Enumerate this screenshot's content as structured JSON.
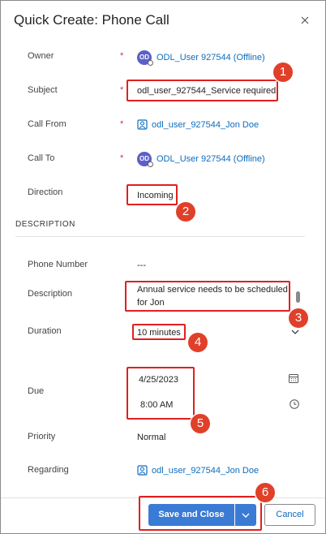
{
  "dialog": {
    "title": "Quick Create: Phone Call"
  },
  "fields": {
    "owner": {
      "label": "Owner",
      "required": "*",
      "avatar": "OD",
      "value": "ODL_User 927544 (Offline)"
    },
    "subject": {
      "label": "Subject",
      "required": "*",
      "value": "odl_user_927544_Service required"
    },
    "call_from": {
      "label": "Call From",
      "required": "*",
      "value": "odl_user_927544_Jon Doe"
    },
    "call_to": {
      "label": "Call To",
      "required": "*",
      "avatar": "OD",
      "value": "ODL_User 927544 (Offline)"
    },
    "direction": {
      "label": "Direction",
      "value": "Incoming"
    }
  },
  "description_section": {
    "title": "DESCRIPTION",
    "phone_number": {
      "label": "Phone Number",
      "value": "---"
    },
    "description": {
      "label": "Description",
      "line1": "Annual service needs to be scheduled",
      "line2": "for Jon"
    },
    "duration": {
      "label": "Duration",
      "value": "10 minutes"
    },
    "due": {
      "label": "Due",
      "date": "4/25/2023",
      "time": "8:00 AM"
    },
    "priority": {
      "label": "Priority",
      "value": "Normal"
    },
    "regarding": {
      "label": "Regarding",
      "value": "odl_user_927544_Jon Doe"
    }
  },
  "footer": {
    "save_label": "Save and Close",
    "cancel_label": "Cancel"
  },
  "annotations": [
    "1",
    "2",
    "3",
    "4",
    "5",
    "6"
  ],
  "colors": {
    "accent": "#0f6cbd",
    "button": "#3a7bd5",
    "highlight": "#e02020",
    "badge": "#e0402a",
    "required": "#d13438"
  },
  "icons": {
    "close": "close-icon",
    "record": "record-icon",
    "calendar": "calendar-icon",
    "clock": "clock-icon",
    "chevron": "chevron-down-icon"
  }
}
